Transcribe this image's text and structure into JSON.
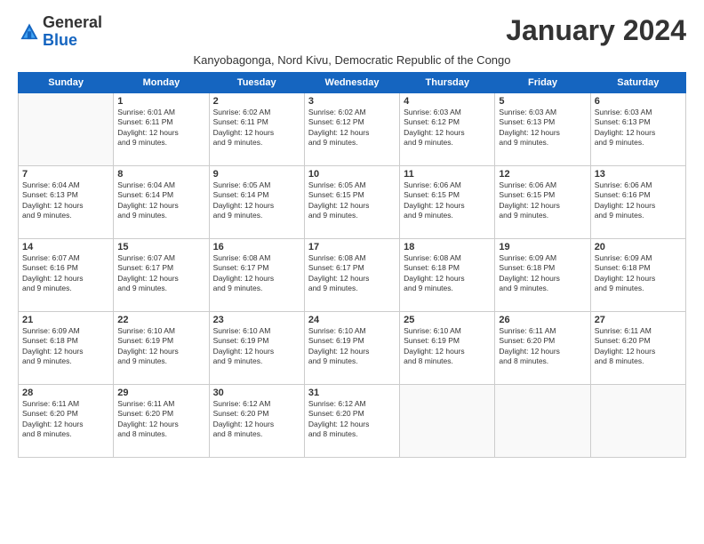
{
  "logo": {
    "general": "General",
    "blue": "Blue"
  },
  "title": "January 2024",
  "location": "Kanyobagonga, Nord Kivu, Democratic Republic of the Congo",
  "days_of_week": [
    "Sunday",
    "Monday",
    "Tuesday",
    "Wednesday",
    "Thursday",
    "Friday",
    "Saturday"
  ],
  "weeks": [
    [
      {
        "day": "",
        "info": ""
      },
      {
        "day": "1",
        "info": "Sunrise: 6:01 AM\nSunset: 6:11 PM\nDaylight: 12 hours\nand 9 minutes."
      },
      {
        "day": "2",
        "info": "Sunrise: 6:02 AM\nSunset: 6:11 PM\nDaylight: 12 hours\nand 9 minutes."
      },
      {
        "day": "3",
        "info": "Sunrise: 6:02 AM\nSunset: 6:12 PM\nDaylight: 12 hours\nand 9 minutes."
      },
      {
        "day": "4",
        "info": "Sunrise: 6:03 AM\nSunset: 6:12 PM\nDaylight: 12 hours\nand 9 minutes."
      },
      {
        "day": "5",
        "info": "Sunrise: 6:03 AM\nSunset: 6:13 PM\nDaylight: 12 hours\nand 9 minutes."
      },
      {
        "day": "6",
        "info": "Sunrise: 6:03 AM\nSunset: 6:13 PM\nDaylight: 12 hours\nand 9 minutes."
      }
    ],
    [
      {
        "day": "7",
        "info": "Sunrise: 6:04 AM\nSunset: 6:13 PM\nDaylight: 12 hours\nand 9 minutes."
      },
      {
        "day": "8",
        "info": "Sunrise: 6:04 AM\nSunset: 6:14 PM\nDaylight: 12 hours\nand 9 minutes."
      },
      {
        "day": "9",
        "info": "Sunrise: 6:05 AM\nSunset: 6:14 PM\nDaylight: 12 hours\nand 9 minutes."
      },
      {
        "day": "10",
        "info": "Sunrise: 6:05 AM\nSunset: 6:15 PM\nDaylight: 12 hours\nand 9 minutes."
      },
      {
        "day": "11",
        "info": "Sunrise: 6:06 AM\nSunset: 6:15 PM\nDaylight: 12 hours\nand 9 minutes."
      },
      {
        "day": "12",
        "info": "Sunrise: 6:06 AM\nSunset: 6:15 PM\nDaylight: 12 hours\nand 9 minutes."
      },
      {
        "day": "13",
        "info": "Sunrise: 6:06 AM\nSunset: 6:16 PM\nDaylight: 12 hours\nand 9 minutes."
      }
    ],
    [
      {
        "day": "14",
        "info": "Sunrise: 6:07 AM\nSunset: 6:16 PM\nDaylight: 12 hours\nand 9 minutes."
      },
      {
        "day": "15",
        "info": "Sunrise: 6:07 AM\nSunset: 6:17 PM\nDaylight: 12 hours\nand 9 minutes."
      },
      {
        "day": "16",
        "info": "Sunrise: 6:08 AM\nSunset: 6:17 PM\nDaylight: 12 hours\nand 9 minutes."
      },
      {
        "day": "17",
        "info": "Sunrise: 6:08 AM\nSunset: 6:17 PM\nDaylight: 12 hours\nand 9 minutes."
      },
      {
        "day": "18",
        "info": "Sunrise: 6:08 AM\nSunset: 6:18 PM\nDaylight: 12 hours\nand 9 minutes."
      },
      {
        "day": "19",
        "info": "Sunrise: 6:09 AM\nSunset: 6:18 PM\nDaylight: 12 hours\nand 9 minutes."
      },
      {
        "day": "20",
        "info": "Sunrise: 6:09 AM\nSunset: 6:18 PM\nDaylight: 12 hours\nand 9 minutes."
      }
    ],
    [
      {
        "day": "21",
        "info": "Sunrise: 6:09 AM\nSunset: 6:18 PM\nDaylight: 12 hours\nand 9 minutes."
      },
      {
        "day": "22",
        "info": "Sunrise: 6:10 AM\nSunset: 6:19 PM\nDaylight: 12 hours\nand 9 minutes."
      },
      {
        "day": "23",
        "info": "Sunrise: 6:10 AM\nSunset: 6:19 PM\nDaylight: 12 hours\nand 9 minutes."
      },
      {
        "day": "24",
        "info": "Sunrise: 6:10 AM\nSunset: 6:19 PM\nDaylight: 12 hours\nand 9 minutes."
      },
      {
        "day": "25",
        "info": "Sunrise: 6:10 AM\nSunset: 6:19 PM\nDaylight: 12 hours\nand 8 minutes."
      },
      {
        "day": "26",
        "info": "Sunrise: 6:11 AM\nSunset: 6:20 PM\nDaylight: 12 hours\nand 8 minutes."
      },
      {
        "day": "27",
        "info": "Sunrise: 6:11 AM\nSunset: 6:20 PM\nDaylight: 12 hours\nand 8 minutes."
      }
    ],
    [
      {
        "day": "28",
        "info": "Sunrise: 6:11 AM\nSunset: 6:20 PM\nDaylight: 12 hours\nand 8 minutes."
      },
      {
        "day": "29",
        "info": "Sunrise: 6:11 AM\nSunset: 6:20 PM\nDaylight: 12 hours\nand 8 minutes."
      },
      {
        "day": "30",
        "info": "Sunrise: 6:12 AM\nSunset: 6:20 PM\nDaylight: 12 hours\nand 8 minutes."
      },
      {
        "day": "31",
        "info": "Sunrise: 6:12 AM\nSunset: 6:20 PM\nDaylight: 12 hours\nand 8 minutes."
      },
      {
        "day": "",
        "info": ""
      },
      {
        "day": "",
        "info": ""
      },
      {
        "day": "",
        "info": ""
      }
    ]
  ]
}
